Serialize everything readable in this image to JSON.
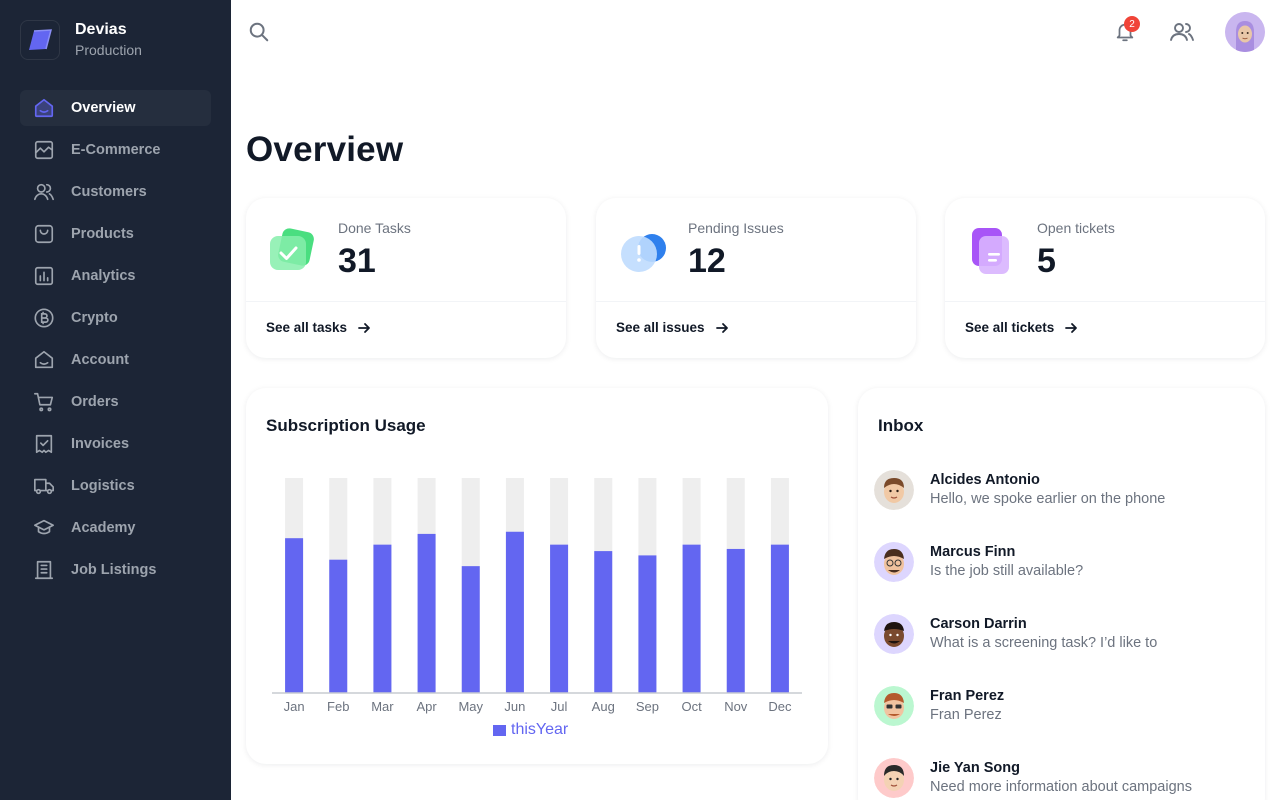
{
  "brand": {
    "name": "Devias",
    "environment": "Production",
    "accent": "#6366f1"
  },
  "nav": {
    "items": [
      {
        "label": "Overview",
        "icon": "home-icon",
        "active": true
      },
      {
        "label": "E-Commerce",
        "icon": "chart-line-icon"
      },
      {
        "label": "Customers",
        "icon": "users-icon"
      },
      {
        "label": "Products",
        "icon": "shopping-bag-icon"
      },
      {
        "label": "Analytics",
        "icon": "bar-chart-icon"
      },
      {
        "label": "Crypto",
        "icon": "bitcoin-icon"
      },
      {
        "label": "Account",
        "icon": "home-smile-icon"
      },
      {
        "label": "Orders",
        "icon": "shopping-cart-icon"
      },
      {
        "label": "Invoices",
        "icon": "receipt-check-icon"
      },
      {
        "label": "Logistics",
        "icon": "truck-icon"
      },
      {
        "label": "Academy",
        "icon": "graduation-hat-icon"
      },
      {
        "label": "Job Listings",
        "icon": "building-icon"
      }
    ]
  },
  "topbar": {
    "notifications_count": "2"
  },
  "page": {
    "title": "Overview"
  },
  "stats": [
    {
      "label": "Done Tasks",
      "value": "31",
      "link": "See all tasks",
      "icon": "check-folder-icon"
    },
    {
      "label": "Pending Issues",
      "value": "12",
      "link": "See all issues",
      "icon": "alert-bubble-icon"
    },
    {
      "label": "Open tickets",
      "value": "5",
      "link": "See all tickets",
      "icon": "ticket-document-icon"
    }
  ],
  "subscription": {
    "title": "Subscription Usage",
    "legend": "thisYear"
  },
  "chart_data": {
    "type": "bar",
    "title": "Subscription Usage",
    "categories": [
      "Jan",
      "Feb",
      "Mar",
      "Apr",
      "May",
      "Jun",
      "Jul",
      "Aug",
      "Sep",
      "Oct",
      "Nov",
      "Dec"
    ],
    "series": [
      {
        "name": "thisYear",
        "color": "#6366f1",
        "values": [
          72,
          62,
          69,
          74,
          59,
          75,
          69,
          66,
          64,
          69,
          67,
          69
        ]
      }
    ],
    "background_track_color": "#eeeeee",
    "ylim": [
      0,
      100
    ],
    "legend_position": "bottom"
  },
  "inbox": {
    "title": "Inbox",
    "messages": [
      {
        "name": "Alcides Antonio",
        "text": "Hello, we spoke earlier on the phone",
        "avatar_bg": "#e8e3dc"
      },
      {
        "name": "Marcus Finn",
        "text": "Is the job still available?",
        "avatar_bg": "#ddd6fe"
      },
      {
        "name": "Carson Darrin",
        "text": "What is a screening task? I’d like to",
        "avatar_bg": "#ddd6fe"
      },
      {
        "name": "Fran Perez",
        "text": "Fran Perez",
        "avatar_bg": "#bbf7d0"
      },
      {
        "name": "Jie Yan Song",
        "text": "Need more information about campaigns",
        "avatar_bg": "#fecaca"
      }
    ]
  }
}
